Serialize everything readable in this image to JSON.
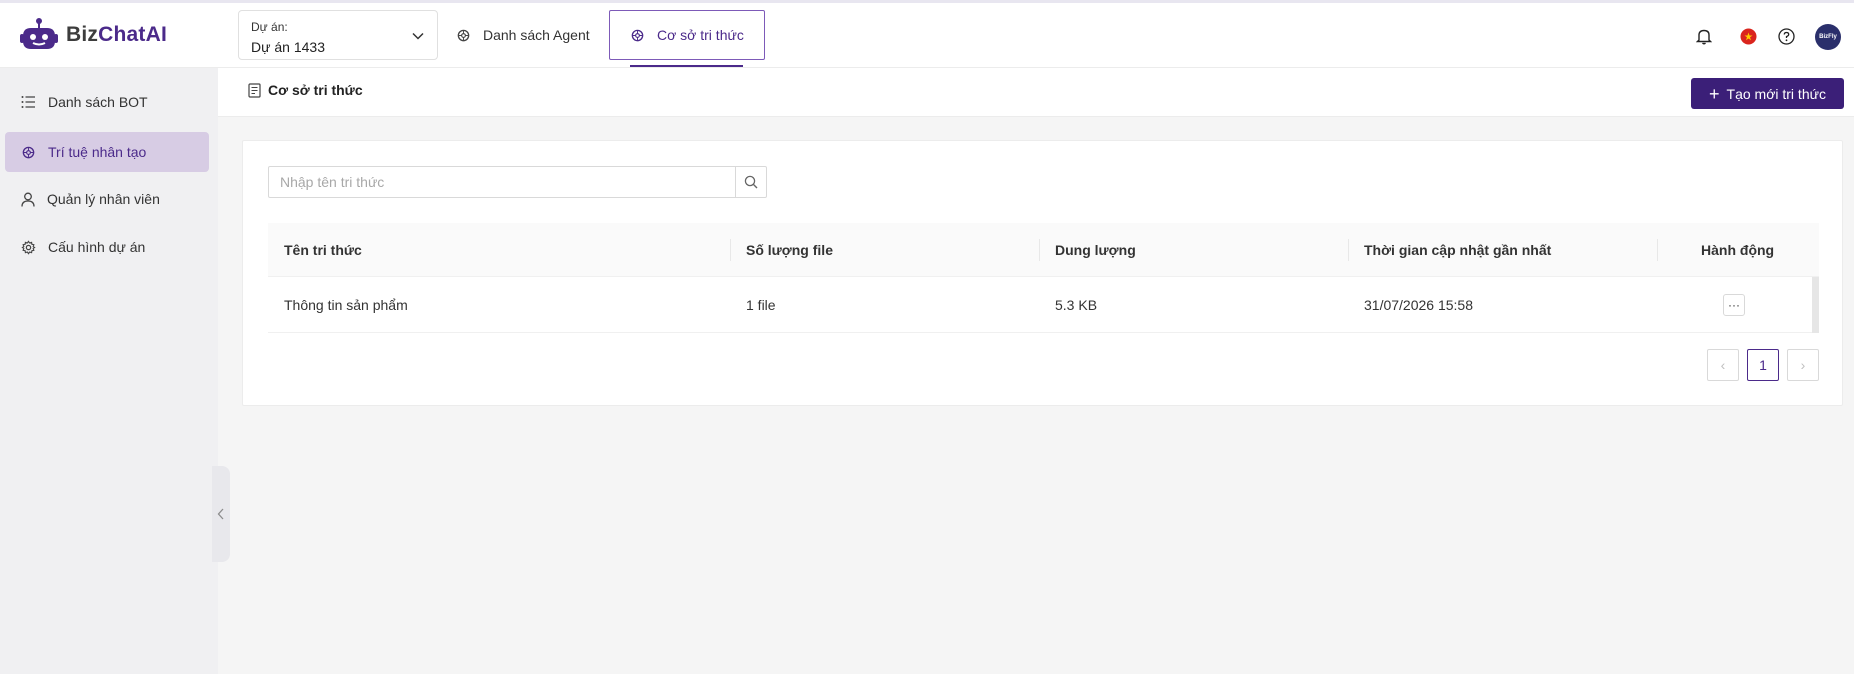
{
  "app": {
    "logo_text_1": "Biz",
    "logo_text_2": "ChatAI"
  },
  "header": {
    "project_label": "Dự án:",
    "project_value": "Dự án 1433",
    "tabs": [
      {
        "label": "Danh sách Agent",
        "active": false
      },
      {
        "label": "Cơ sở tri thức",
        "active": true
      }
    ],
    "icons": [
      "bell-icon",
      "vietnam-flag-icon",
      "help-icon",
      "user-avatar"
    ],
    "avatar_text": "BizFly",
    "accent_color": "#4b2a8a"
  },
  "sidebar": {
    "items": [
      {
        "label": "Danh sách BOT",
        "icon": "list-icon",
        "active": false
      },
      {
        "label": "Trí tuệ nhân tạo",
        "icon": "ai-icon",
        "active": true
      },
      {
        "label": "Quản lý nhân viên",
        "icon": "user-icon",
        "active": false
      },
      {
        "label": "Cấu hình dự án",
        "icon": "gear-icon",
        "active": false
      }
    ]
  },
  "page": {
    "title": "Cơ sở tri thức",
    "create_button": "Tạo mới tri thức",
    "search_placeholder": "Nhập tên tri thức",
    "table": {
      "columns": [
        "Tên tri thức",
        "Số lượng file",
        "Dung lượng",
        "Thời gian cập nhật gần nhất",
        "Hành động"
      ],
      "rows": [
        {
          "name": "Thông tin sản phẩm",
          "files": "1 file",
          "size": "5.3 KB",
          "updated": "31/07/2026 15:58",
          "action": "···"
        }
      ]
    },
    "pagination": {
      "prev": "‹",
      "current": "1",
      "next": "›"
    }
  }
}
